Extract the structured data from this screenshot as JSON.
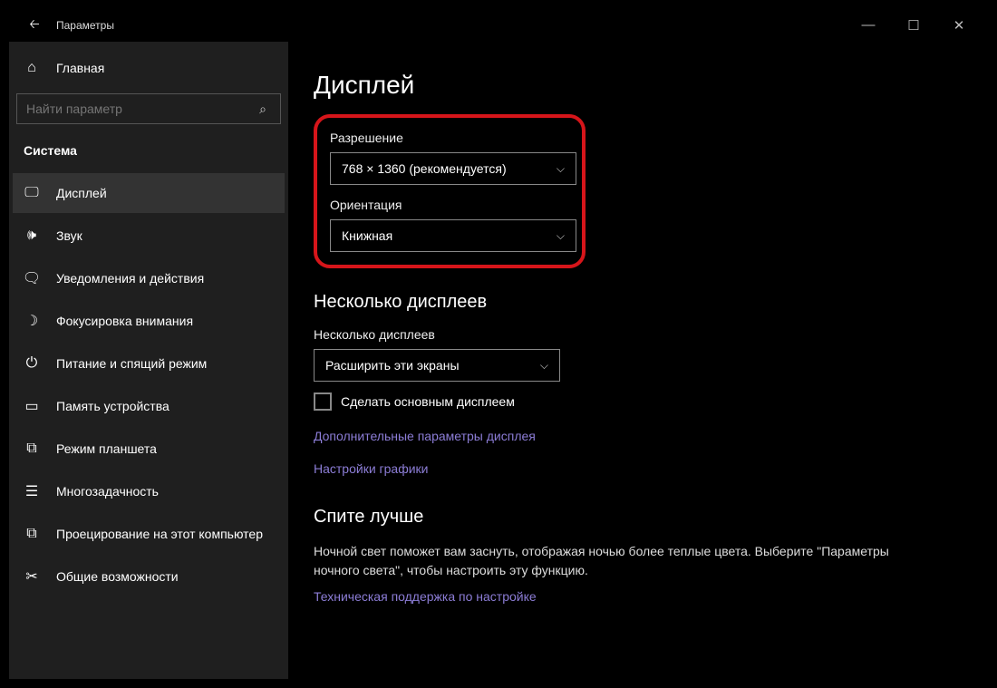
{
  "titlebar": {
    "title": "Параметры"
  },
  "sidebar": {
    "home": "Главная",
    "search_placeholder": "Найти параметр",
    "section": "Система",
    "items": [
      {
        "label": "Дисплей"
      },
      {
        "label": "Звук"
      },
      {
        "label": "Уведомления и действия"
      },
      {
        "label": "Фокусировка внимания"
      },
      {
        "label": "Питание и спящий режим"
      },
      {
        "label": "Память устройства"
      },
      {
        "label": "Режим планшета"
      },
      {
        "label": "Многозадачность"
      },
      {
        "label": "Проецирование на этот компьютер"
      },
      {
        "label": "Общие возможности"
      }
    ]
  },
  "main": {
    "heading": "Дисплей",
    "resolution_label": "Разрешение",
    "resolution_value": "768 × 1360 (рекомендуется)",
    "orientation_label": "Ориентация",
    "orientation_value": "Книжная",
    "multi_heading": "Несколько дисплеев",
    "multi_label": "Несколько дисплеев",
    "multi_value": "Расширить эти экраны",
    "checkbox_label": "Сделать основным дисплеем",
    "link_advanced": "Дополнительные параметры дисплея",
    "link_graphics": "Настройки графики",
    "sleep_heading": "Спите лучше",
    "sleep_body": "Ночной свет поможет вам заснуть, отображая ночью более теплые цвета. Выберите \"Параметры ночного света\", чтобы настроить эту функцию.",
    "link_support": "Техническая поддержка по настройке"
  }
}
